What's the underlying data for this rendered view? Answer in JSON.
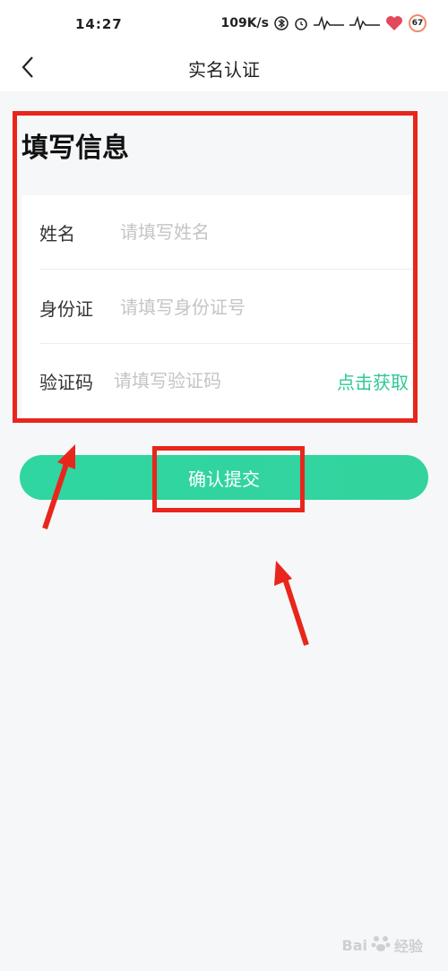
{
  "status_bar": {
    "time": "14:27",
    "net_speed": "109K/s",
    "battery": "67",
    "icons": [
      "bluetooth-icon",
      "alarm-icon",
      "signal-icon",
      "signal-icon",
      "heart-icon"
    ]
  },
  "nav": {
    "title": "实名认证",
    "back_icon": "chevron-left-icon"
  },
  "form": {
    "section_title": "填写信息",
    "name": {
      "label": "姓名",
      "placeholder": "请填写姓名",
      "value": ""
    },
    "id_card": {
      "label": "身份证",
      "placeholder": "请填写身份证号",
      "value": ""
    },
    "code": {
      "label": "验证码",
      "placeholder": "请填写验证码",
      "value": "",
      "action": "点击获取"
    }
  },
  "submit": {
    "label": "确认提交"
  },
  "colors": {
    "accent": "#2fd6a1",
    "annotation": "#e8261c",
    "background": "#f6f7f9"
  },
  "watermark": {
    "text": "Bai",
    "text2": "经验"
  }
}
